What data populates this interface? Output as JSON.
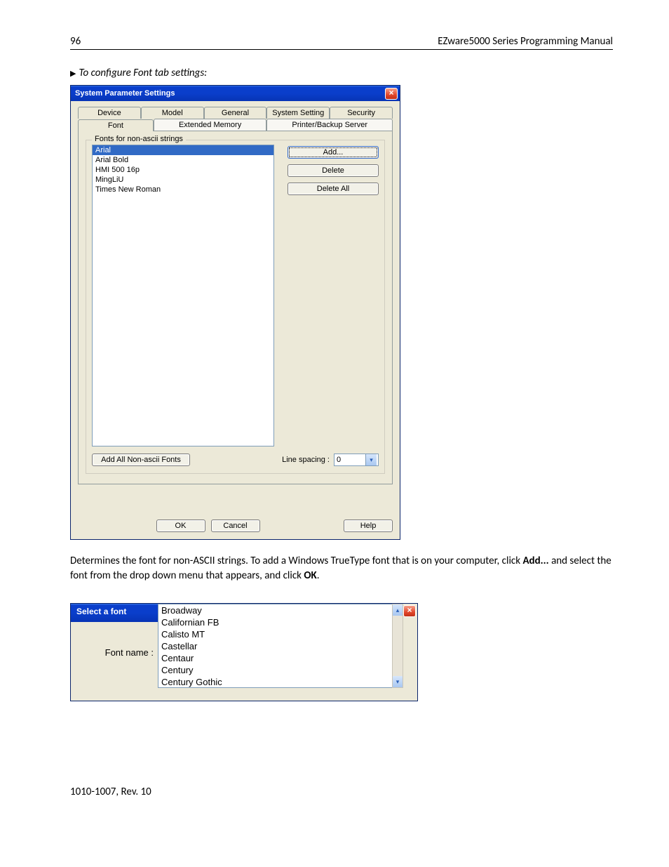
{
  "header": {
    "page_number": "96",
    "manual_title": "EZware5000 Series Programming Manual"
  },
  "section_heading": "To configure Font tab settings:",
  "dialog1": {
    "title": "System Parameter Settings",
    "tabs_back": [
      "Device",
      "Model",
      "General",
      "System Setting",
      "Security"
    ],
    "tabs_front": [
      "Font",
      "Extended Memory",
      "Printer/Backup Server"
    ],
    "active_tab": "Font",
    "group_title": "Fonts for non-ascii strings",
    "font_list": [
      "Arial",
      "Arial Bold",
      "HMI 500 16p",
      "MingLiU",
      "Times New Roman"
    ],
    "selected_font": "Arial",
    "buttons": {
      "add": "Add...",
      "delete": "Delete",
      "delete_all": "Delete All",
      "add_all": "Add All Non-ascii Fonts"
    },
    "line_spacing_label": "Line spacing :",
    "line_spacing_value": "0",
    "footer": {
      "ok": "OK",
      "cancel": "Cancel",
      "help": "Help"
    }
  },
  "paragraph": {
    "pre": "Determines the font for non-ASCII strings. To add a Windows TrueType font that is on your computer, click ",
    "bold1": "Add...",
    "mid": " and select the font from the drop down menu that appears, and click ",
    "bold2": "OK",
    "post": "."
  },
  "dialog2": {
    "title": "Select a font",
    "label": "Font name :",
    "options": [
      "Broadway",
      "Californian FB",
      "Calisto MT",
      "Castellar",
      "Centaur",
      "Century",
      "Century Gothic"
    ]
  },
  "footer_text": "1010-1007, Rev. 10"
}
